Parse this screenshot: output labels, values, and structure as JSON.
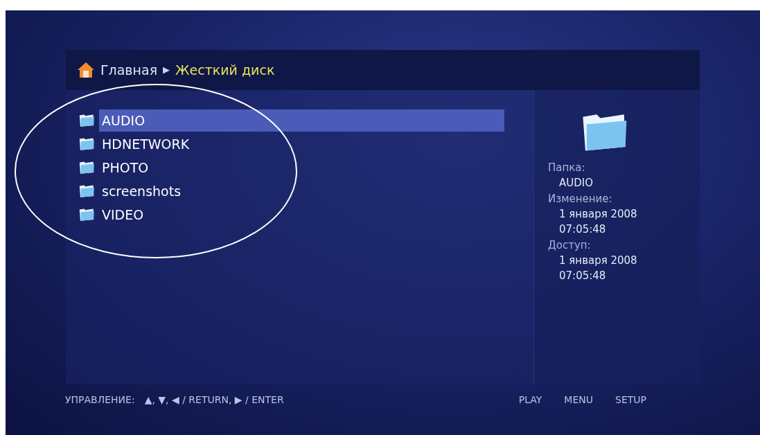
{
  "breadcrumb": [
    {
      "label": "Главная",
      "current": false
    },
    {
      "label": "Жесткий диск",
      "current": true
    }
  ],
  "breadcrumb_separator": "▶",
  "files": [
    {
      "name": "AUDIO",
      "selected": true
    },
    {
      "name": "HDNETWORK",
      "selected": false
    },
    {
      "name": "PHOTO",
      "selected": false
    },
    {
      "name": "screenshots",
      "selected": false
    },
    {
      "name": "VIDEO",
      "selected": false
    }
  ],
  "info": [
    {
      "label": "Папка:",
      "values": [
        "AUDIO"
      ]
    },
    {
      "label": "Изменение:",
      "values": [
        "1 января 2008",
        "07:05:48"
      ]
    },
    {
      "label": "Доступ:",
      "values": [
        "1 января 2008",
        "07:05:48"
      ]
    }
  ],
  "footer": {
    "hint_label": "УПРАВЛЕНИЕ:",
    "hint": "▲, ▼, ◀ / RETURN, ▶ / ENTER",
    "buttons": [
      "PLAY",
      "MENU",
      "SETUP"
    ]
  }
}
